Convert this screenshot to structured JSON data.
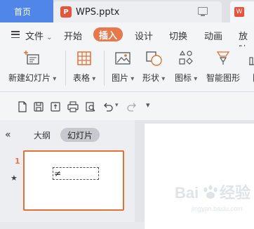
{
  "tabs": {
    "home_label": "首页",
    "doc_title": "WPS.pptx",
    "doc_logo_text": "P",
    "third_logo_text": "W"
  },
  "menu": {
    "file_label": "文件",
    "start_label": "开始",
    "insert_label": "插入",
    "design_label": "设计",
    "transition_label": "切换",
    "animation_label": "动画",
    "slideshow_label": "放映"
  },
  "ribbon": {
    "new_slide_label": "新建幻灯片",
    "table_label": "表格",
    "picture_label": "图片",
    "shape_label": "形状",
    "icon_label": "图标",
    "smartart_label": "智能图形",
    "chart_label": "图"
  },
  "panel": {
    "outline_label": "大纲",
    "slides_label": "幻灯片",
    "slide_number": "1",
    "slide_star": "★",
    "cursor_glyph": "≠"
  },
  "watermark": {
    "text": "Baidu经验",
    "subtext": "jingyan.baidu.com"
  },
  "colors": {
    "home_tab": "#4f86e8",
    "active_menu": "#e8784a",
    "slide_border": "#e07235",
    "wps_logo": "#e8533b"
  }
}
